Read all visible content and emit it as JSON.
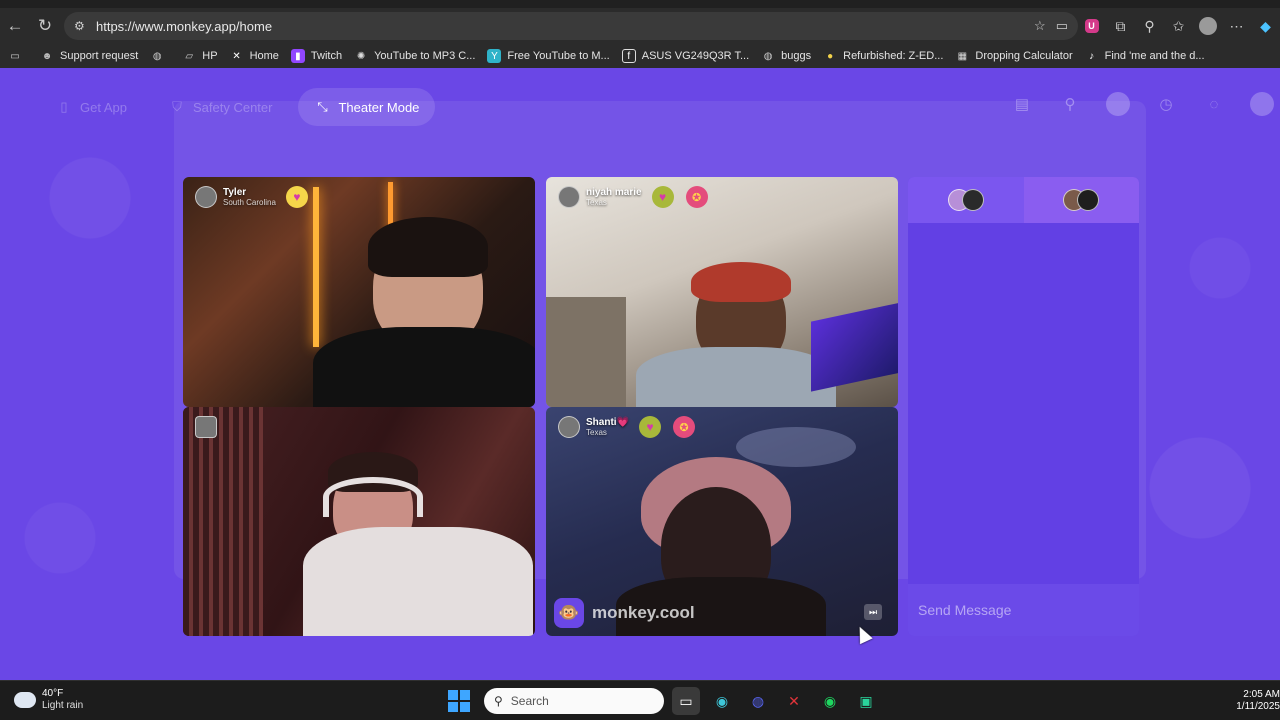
{
  "browser": {
    "url": "https://www.monkey.app/home",
    "bookmarks": [
      {
        "label": "Support request",
        "icon": "robot-icon"
      },
      {
        "label": "",
        "icon": "globe-icon"
      },
      {
        "label": "HP",
        "icon": "folder-icon"
      },
      {
        "label": "Home",
        "icon": "x-logo-icon"
      },
      {
        "label": "Twitch",
        "icon": "twitch-icon"
      },
      {
        "label": "YouTube to MP3 C...",
        "icon": "converter-icon"
      },
      {
        "label": "Free YouTube to M...",
        "icon": "converter-icon"
      },
      {
        "label": "ASUS VG249Q3R T...",
        "icon": "asus-icon"
      },
      {
        "label": "buggs",
        "icon": "globe-icon"
      },
      {
        "label": "Refurbished: Z-ED...",
        "icon": "coin-icon"
      },
      {
        "label": "Dropping Calculator",
        "icon": "calculator-icon"
      },
      {
        "label": "Find 'me and the d...",
        "icon": "tiktok-icon"
      }
    ]
  },
  "page": {
    "nav": {
      "get_app": "Get App",
      "safety_center": "Safety Center",
      "theater_mode": "Theater Mode"
    },
    "tiles": [
      {
        "name": "Tyler",
        "location": "South Carolina"
      },
      {
        "name": "niyah marie",
        "location": "Texas"
      },
      {
        "name": "",
        "location": ""
      },
      {
        "name": "Shanti💗",
        "location": "Texas"
      }
    ],
    "watermark": "monkey.cool",
    "chat": {
      "placeholder": "Send Message"
    }
  },
  "taskbar": {
    "weather_temp": "40°F",
    "weather_desc": "Light rain",
    "search_placeholder": "Search",
    "time": "2:05 AM",
    "date": "1/11/2025"
  }
}
